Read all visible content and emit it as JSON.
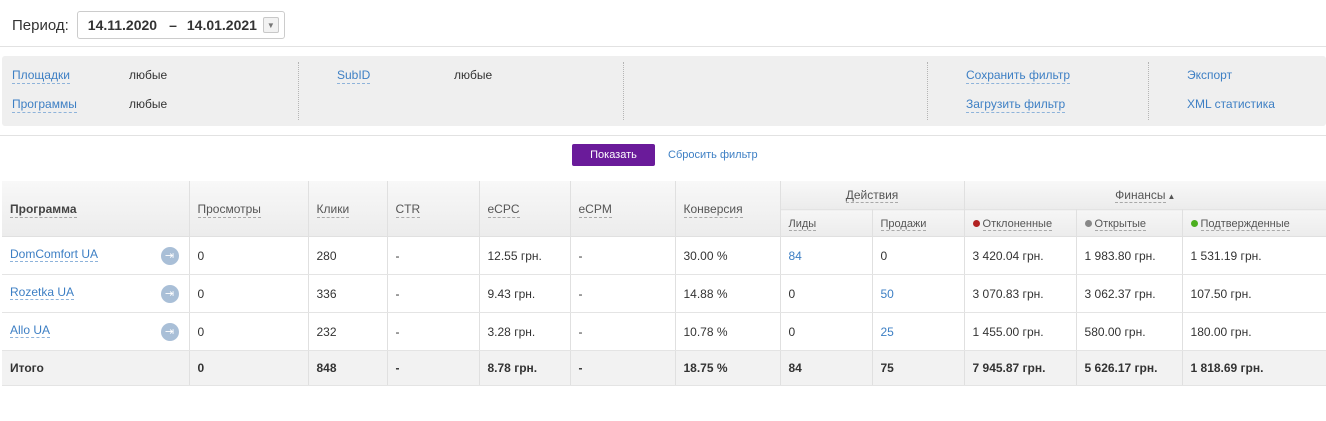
{
  "period": {
    "label": "Период:",
    "from": "14.11.2020",
    "dash": "–",
    "to": "14.01.2021"
  },
  "filter": {
    "platforms_label": "Площадки",
    "platforms_value": "любые",
    "programs_label": "Программы",
    "programs_value": "любые",
    "subid_label": "SubID",
    "subid_value": "любые",
    "save_label": "Сохранить фильтр",
    "load_label": "Загрузить фильтр",
    "export_label": "Экспорт",
    "xml_label": "XML статистика"
  },
  "actions": {
    "show": "Показать",
    "reset": "Сбросить фильтр"
  },
  "table": {
    "headers": {
      "program": "Программа",
      "views": "Просмотры",
      "clicks": "Клики",
      "ctr": "CTR",
      "ecpc": "eCPC",
      "ecpm": "eCPM",
      "conversion": "Конверсия",
      "actions": "Действия",
      "finance": "Финансы",
      "leads": "Лиды",
      "sales": "Продажи",
      "declined": "Отклоненные",
      "open": "Открытые",
      "confirmed": "Подтвержденные"
    },
    "sort_indicator": "▲",
    "rows": [
      {
        "program": "DomComfort UA",
        "views": "0",
        "clicks": "280",
        "ctr": "-",
        "ecpc": "12.55 грн.",
        "ecpm": "-",
        "conversion": "30.00 %",
        "leads": "84",
        "sales": "0",
        "declined": "3 420.04 грн.",
        "open": "1 983.80 грн.",
        "confirmed": "1 531.19 грн."
      },
      {
        "program": "Rozetka UA",
        "views": "0",
        "clicks": "336",
        "ctr": "-",
        "ecpc": "9.43 грн.",
        "ecpm": "-",
        "conversion": "14.88 %",
        "leads": "0",
        "sales": "50",
        "declined": "3 070.83 грн.",
        "open": "3 062.37 грн.",
        "confirmed": "107.50 грн."
      },
      {
        "program": "Allo UA",
        "views": "0",
        "clicks": "232",
        "ctr": "-",
        "ecpc": "3.28 грн.",
        "ecpm": "-",
        "conversion": "10.78 %",
        "leads": "0",
        "sales": "25",
        "declined": "1 455.00 грн.",
        "open": "580.00 грн.",
        "confirmed": "180.00 грн."
      }
    ],
    "total": {
      "program": "Итого",
      "views": "0",
      "clicks": "848",
      "ctr": "-",
      "ecpc": "8.78 грн.",
      "ecpm": "-",
      "conversion": "18.75 %",
      "leads": "84",
      "sales": "75",
      "declined": "7 945.87 грн.",
      "open": "5 626.17 грн.",
      "confirmed": "1 818.69 грн."
    }
  },
  "colors": {
    "accent": "#6a1b9a",
    "link": "#3d7fc4",
    "declined_dot": "#b22222",
    "open_dot": "#888888",
    "confirmed_dot": "#4caf1f"
  },
  "icons": {
    "period_dropdown": "chevron-down-icon",
    "row_login": "login-icon"
  }
}
